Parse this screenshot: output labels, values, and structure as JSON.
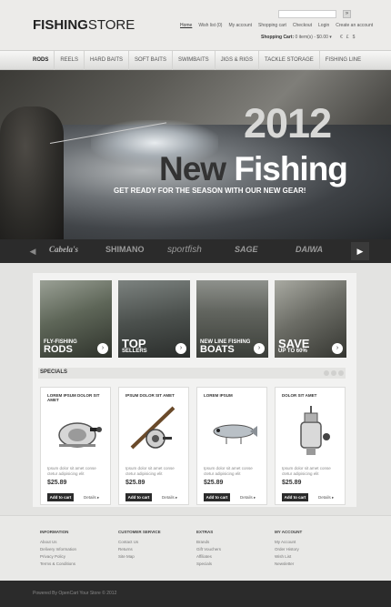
{
  "header": {
    "logo_bold": "FISHING",
    "logo_light": "STORE",
    "search_button": "»",
    "links": [
      "Home",
      "Wish list (0)",
      "My account",
      "Shopping cart",
      "Checkout",
      "Login",
      "Create an account"
    ],
    "cart_label": "Shopping Cart:",
    "cart_value": "0 item(s) - $0.00 ▾",
    "currencies": [
      "€",
      "£",
      "$"
    ]
  },
  "nav": {
    "items": [
      "RODS",
      "REELS",
      "HARD BAITS",
      "SOFT BAITS",
      "SWIMBAITS",
      "JIGS & RIGS",
      "TACKLE STORAGE",
      "FISHING LINE"
    ]
  },
  "hero": {
    "year": "2012",
    "headline_a": "New",
    "headline_b": "Fishing",
    "tagline": "GET READY FOR THE SEASON WITH OUR NEW GEAR!"
  },
  "brands": {
    "prev": "◀",
    "next": "▶",
    "items": [
      "Cabela's",
      "SHIMANO",
      "sportfish",
      "SAGE",
      "DAIWA"
    ]
  },
  "banners": [
    {
      "small": "FLY-FISHING",
      "large": "RODS",
      "go": "›"
    },
    {
      "small": "SELLERS",
      "large": "TOP",
      "go": "›"
    },
    {
      "small": "NEW LINE FISHING",
      "large": "BOATS",
      "go": "›"
    },
    {
      "small": "UP TO 60%",
      "large": "SAVE",
      "go": "›"
    }
  ],
  "specials": {
    "title": "SPECIALS",
    "products": [
      {
        "name": "LOREM IPSUM DOLOR SIT AMET",
        "desc": "Ipsum dolor sit amet conse ctetur adipisicing elit",
        "price": "$25.89",
        "add": "Add to cart",
        "details": "Details ▸"
      },
      {
        "name": "IPSUM DOLOR SIT AMET",
        "desc": "Ipsum dolor sit amet conse ctetur adipisicing elit",
        "price": "$25.89",
        "add": "Add to cart",
        "details": "Details ▸"
      },
      {
        "name": "LOREM IPSUM",
        "desc": "Ipsum dolor sit amet conse ctetur adipisicing elit",
        "price": "$25.89",
        "add": "Add to cart",
        "details": "Details ▸"
      },
      {
        "name": "DOLOR SIT AMET",
        "desc": "Ipsum dolor sit amet conse ctetur adipisicing elit",
        "price": "$25.89",
        "add": "Add to cart",
        "details": "Details ▸"
      }
    ]
  },
  "footer": {
    "columns": [
      {
        "heading": "INFORMATION",
        "items": [
          "About Us",
          "Delivery Information",
          "Privacy Policy",
          "Terms & Conditions"
        ]
      },
      {
        "heading": "CUSTOMER SERVICE",
        "items": [
          "Contact Us",
          "Returns",
          "Site Map"
        ]
      },
      {
        "heading": "EXTRAS",
        "items": [
          "Brands",
          "Gift Vouchers",
          "Affiliates",
          "Specials"
        ]
      },
      {
        "heading": "MY ACCOUNT",
        "items": [
          "My Account",
          "Order History",
          "Wish List",
          "Newsletter"
        ]
      }
    ],
    "copyright": "Powered By OpenCart Your Store © 2012"
  }
}
